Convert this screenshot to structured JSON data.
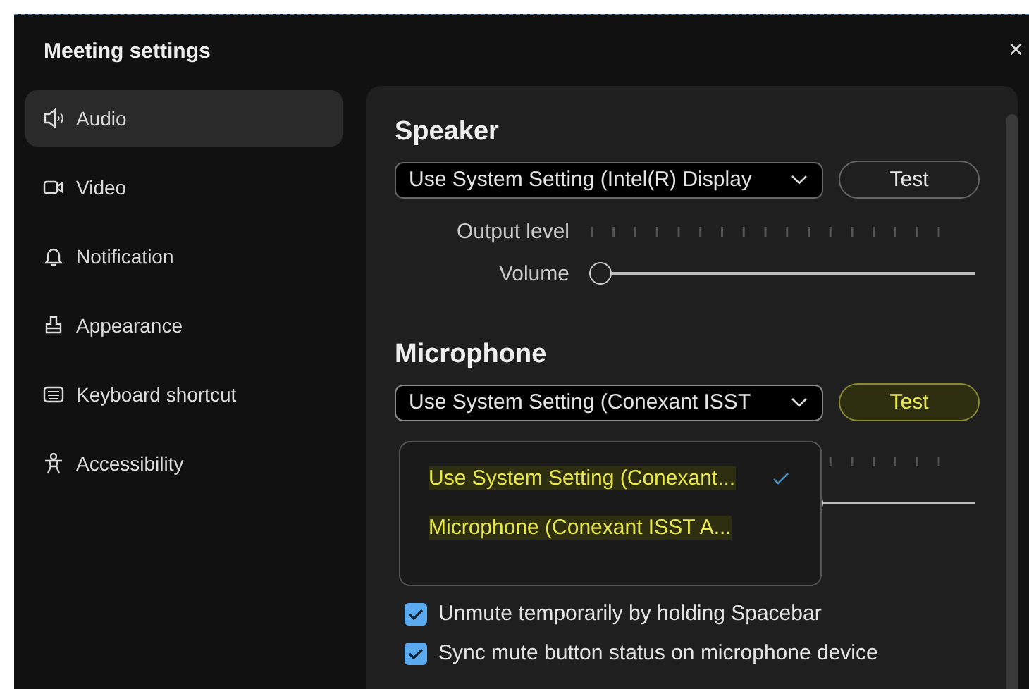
{
  "window": {
    "title": "Meeting settings",
    "close": "×"
  },
  "sidebar": {
    "items": [
      {
        "label": "Audio",
        "selected": true
      },
      {
        "label": "Video",
        "selected": false
      },
      {
        "label": "Notification",
        "selected": false
      },
      {
        "label": "Appearance",
        "selected": false
      },
      {
        "label": "Keyboard shortcut",
        "selected": false
      },
      {
        "label": "Accessibility",
        "selected": false
      }
    ]
  },
  "speaker": {
    "heading": "Speaker",
    "device": {
      "value": "Use System Setting (Intel(R) Display",
      "expanded": false
    },
    "test_button": {
      "label": "Test",
      "highlighted": false
    },
    "output_level": {
      "label": "Output level"
    },
    "volume": {
      "label": "Volume",
      "level": 0
    }
  },
  "microphone": {
    "heading": "Microphone",
    "device": {
      "value": "Use System Setting (Conexant ISST",
      "expanded": true
    },
    "test_button": {
      "label": "Test",
      "highlighted": true
    },
    "volume": {
      "level": 0.58
    },
    "device_menu": [
      {
        "label": "Use System Setting (Conexant...",
        "selected": true,
        "highlighted": true
      },
      {
        "label": "Microphone (Conexant ISST A...",
        "selected": false,
        "highlighted": true
      }
    ]
  },
  "checkboxes": [
    {
      "label": "Unmute temporarily by holding Spacebar",
      "checked": true
    },
    {
      "label": "Sync mute button status on microphone device",
      "checked": true
    }
  ]
}
